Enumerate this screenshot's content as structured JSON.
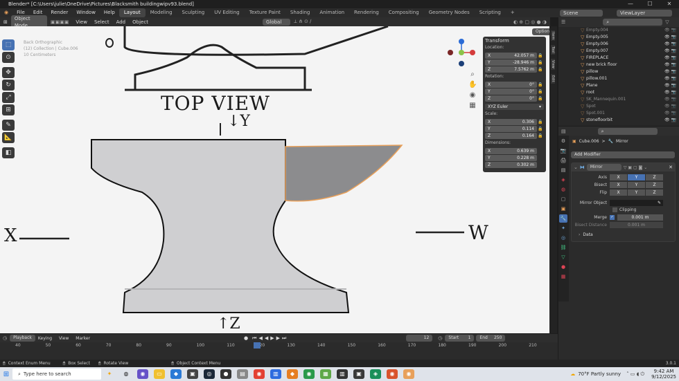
{
  "title_bar": {
    "text": "Blender* [C:\\Users\\julie\\OneDrive\\Pictures\\Blacksmith buildingwipv93.blend]",
    "minimize": "—",
    "maximize": "☐",
    "close": "✕"
  },
  "menu": {
    "items": [
      "File",
      "Edit",
      "Render",
      "Window",
      "Help"
    ],
    "workspaces": [
      "Layout",
      "Modeling",
      "Sculpting",
      "UV Editing",
      "Texture Paint",
      "Shading",
      "Animation",
      "Rendering",
      "Compositing",
      "Geometry Nodes",
      "Scripting"
    ],
    "add_ws": "+",
    "scene": "Scene",
    "view_layer": "ViewLayer"
  },
  "viewport_header": {
    "mode": "Object Mode",
    "items": [
      "View",
      "Select",
      "Add",
      "Object"
    ],
    "orientation": "Global",
    "options": "Options"
  },
  "viewport_info": {
    "line1": "Back Orthographic",
    "line2": "(12) Collection | Cube.006",
    "line3": "10 Centimeters"
  },
  "reference_text": {
    "top_view": "TOP VIEW",
    "y_label": "↓Y",
    "x_label": "X",
    "w_label": "W",
    "z_label": "↑Z",
    "o_label": "O"
  },
  "npanel": {
    "header": "Transform",
    "location_label": "Location:",
    "location": [
      {
        "axis": "X",
        "value": "42.057 m"
      },
      {
        "axis": "Y",
        "value": "-28.946 m"
      },
      {
        "axis": "Z",
        "value": "7.5762 m"
      }
    ],
    "rotation_label": "Rotation:",
    "rotation": [
      {
        "axis": "X",
        "value": "0°"
      },
      {
        "axis": "Y",
        "value": "0°"
      },
      {
        "axis": "Z",
        "value": "0°"
      }
    ],
    "rotation_mode": "XYZ Euler",
    "scale_label": "Scale:",
    "scale": [
      {
        "axis": "X",
        "value": "0.306"
      },
      {
        "axis": "Y",
        "value": "0.114"
      },
      {
        "axis": "Z",
        "value": "0.164"
      }
    ],
    "dimensions_label": "Dimensions:",
    "dimensions": [
      {
        "axis": "X",
        "value": "0.639 m"
      },
      {
        "axis": "Y",
        "value": "0.228 m"
      },
      {
        "axis": "Z",
        "value": "0.302 m"
      }
    ]
  },
  "side_tabs": [
    "Item",
    "Tool",
    "View",
    "Edit"
  ],
  "outliner": {
    "rows": [
      {
        "name": "Empty.004",
        "dim": true
      },
      {
        "name": "Empty.005",
        "dim": false
      },
      {
        "name": "Empty.006",
        "dim": false
      },
      {
        "name": "Empty.007",
        "dim": false
      },
      {
        "name": "FIREPLACE",
        "dim": false
      },
      {
        "name": "new brick floor",
        "dim": false
      },
      {
        "name": "pillow",
        "dim": false
      },
      {
        "name": "pillow.001",
        "dim": false
      },
      {
        "name": "Plane",
        "dim": false
      },
      {
        "name": "root",
        "dim": false
      },
      {
        "name": "SK_Mannequin.001",
        "dim": true
      },
      {
        "name": "Spot",
        "dim": true
      },
      {
        "name": "Spot.001",
        "dim": true
      },
      {
        "name": "stonefloorbit",
        "dim": false
      }
    ]
  },
  "properties": {
    "breadcrumb_obj": "Cube.006",
    "breadcrumb_sep": ">",
    "breadcrumb_mod": "Mirror",
    "add_modifier": "Add Modifier",
    "modifier_name": "Mirror",
    "axis_label": "Axis",
    "bisect_label": "Bisect",
    "flip_label": "Flip",
    "axes": [
      "X",
      "Y",
      "Z"
    ],
    "mirror_object_label": "Mirror Object",
    "clipping_label": "Clipping",
    "merge_label": "Merge",
    "merge_value": "0.001 m",
    "bisect_distance_label": "Bisect Distance",
    "bisect_distance_value": "0.001 m",
    "data_label": "Data"
  },
  "timeline": {
    "menu": [
      "Playback",
      "Keying",
      "View",
      "Marker"
    ],
    "current_frame": "12",
    "start_label": "Start",
    "start": "1",
    "end_label": "End",
    "end": "250",
    "ticks": [
      "40",
      "50",
      "60",
      "70",
      "80",
      "90",
      "100",
      "110",
      "120",
      "130",
      "140",
      "150",
      "160",
      "170",
      "180",
      "190",
      "200",
      "210"
    ]
  },
  "statusbar": {
    "items": [
      "Context Enum Menu",
      "Box Select",
      "Rotate View",
      "Object Context Menu"
    ],
    "version": "3.0.1"
  },
  "taskbar": {
    "search_placeholder": "Type here to search",
    "weather": "70°F  Partly sunny",
    "time": "9:42 AM",
    "date": "9/12/2025"
  },
  "colors": {
    "accent": "#4772b3",
    "selection": "#e8a05a",
    "bg": "#2b2b2b"
  }
}
